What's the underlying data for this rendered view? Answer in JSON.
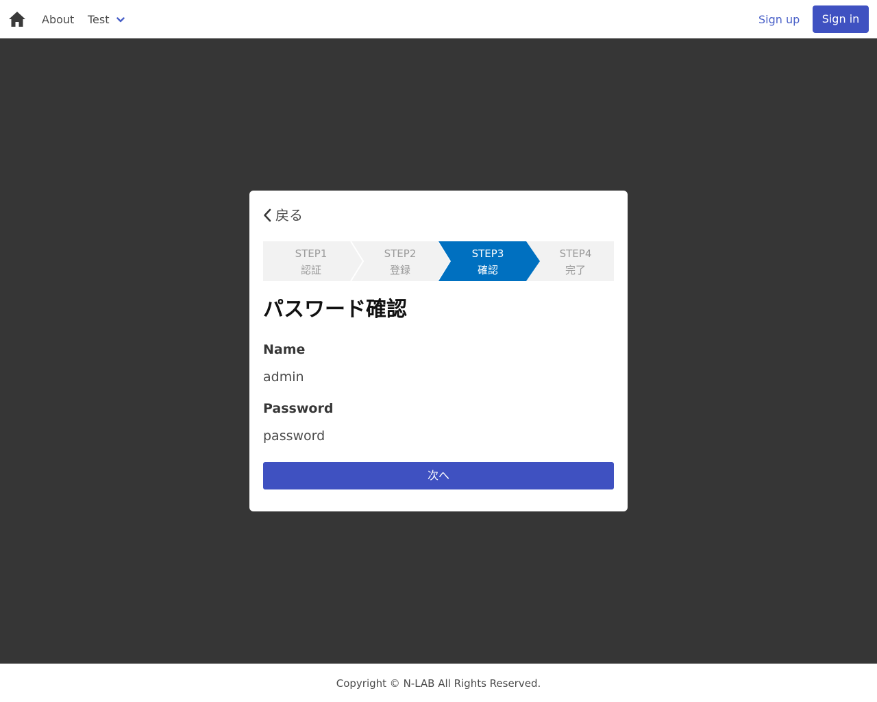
{
  "navbar": {
    "home_icon": "home-icon",
    "about_label": "About",
    "test_label": "Test",
    "dropdown_icon": "chevron-down-icon",
    "signup_label": "Sign up",
    "signin_label": "Sign in"
  },
  "card": {
    "back_icon": "chevron-left-icon",
    "back_label": "戻る",
    "steps": [
      {
        "num": "STEP1",
        "label": "認証",
        "active": false
      },
      {
        "num": "STEP2",
        "label": "登録",
        "active": false
      },
      {
        "num": "STEP3",
        "label": "確認",
        "active": true
      },
      {
        "num": "STEP4",
        "label": "完了",
        "active": false
      }
    ],
    "title": "パスワード確認",
    "fields": [
      {
        "label": "Name",
        "value": "admin"
      },
      {
        "label": "Password",
        "value": "password"
      }
    ],
    "next_label": "次へ"
  },
  "footer": {
    "copyright": "Copyright © N-LAB All Rights Reserved."
  },
  "colors": {
    "primary": "#3f51c1",
    "link": "#485fc7",
    "step_active": "#0070c0",
    "background": "#363636"
  }
}
